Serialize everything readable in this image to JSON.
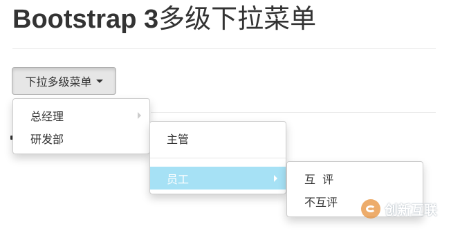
{
  "page": {
    "title_bold": "Bootstrap 3",
    "title_rest": "多级下拉菜单"
  },
  "dropdown": {
    "toggle_label": "下拉多级菜单",
    "menu_l1": [
      {
        "label": "总经理",
        "has_submenu": true
      },
      {
        "label": "研发部",
        "has_submenu": false
      }
    ],
    "menu_l2": [
      {
        "label": "主管",
        "has_submenu": false
      },
      {
        "label": "员工",
        "has_submenu": true,
        "active": true
      }
    ],
    "menu_l3": [
      {
        "label": "互  评"
      },
      {
        "label": "不互评"
      }
    ]
  },
  "watermark": {
    "text": "创新互联"
  },
  "colors": {
    "active_item_bg": "#a6e1f5",
    "toggle_bg": "#e6e6e6",
    "text": "#333333"
  }
}
